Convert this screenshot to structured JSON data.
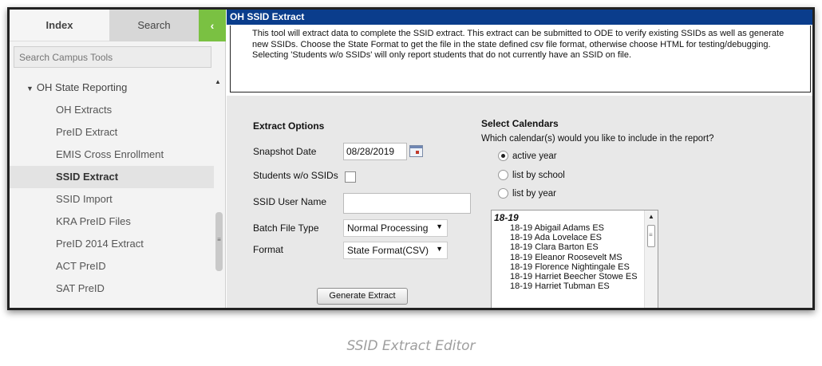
{
  "leftnav": {
    "tabs": {
      "index": "Index",
      "search": "Search",
      "collapse": "‹"
    },
    "search_placeholder": "Search Campus Tools",
    "tree": {
      "parent": "OH State Reporting",
      "items": [
        {
          "label": "OH Extracts"
        },
        {
          "label": "PreID Extract"
        },
        {
          "label": "EMIS Cross Enrollment"
        },
        {
          "label": "SSID Extract",
          "active": true
        },
        {
          "label": "SSID Import"
        },
        {
          "label": "KRA PreID Files"
        },
        {
          "label": "PreID 2014 Extract"
        },
        {
          "label": "ACT PreID"
        },
        {
          "label": "SAT PreID"
        }
      ]
    }
  },
  "main": {
    "title": "OH SSID Extract",
    "description": "This tool will extract data to complete the SSID extract. This extract can be submitted to ODE to verify existing SSIDs as well as generate new SSIDs. Choose the State Format to get the file in the state defined csv file format, otherwise choose HTML for testing/debugging. Selecting 'Students w/o SSIDs' will only report students that do not currently have an SSID on file.",
    "extract_options": {
      "title": "Extract Options",
      "snapshot_label": "Snapshot Date",
      "snapshot_value": "08/28/2019",
      "students_wo_ssid_label": "Students w/o SSIDs",
      "students_wo_ssid_checked": false,
      "ssid_user_label": "SSID User Name",
      "ssid_user_value": "",
      "batch_label": "Batch File Type",
      "batch_value": "Normal Processing",
      "format_label": "Format",
      "format_value": "State Format(CSV)",
      "generate_label": "Generate Extract"
    },
    "calendars": {
      "title": "Select Calendars",
      "question": "Which calendar(s) would you like to include in the report?",
      "options": [
        {
          "label": "active year",
          "checked": true
        },
        {
          "label": "list by school",
          "checked": false
        },
        {
          "label": "list by year",
          "checked": false
        }
      ],
      "year": "18-19",
      "entries": [
        "18-19 Abigail Adams ES",
        "18-19 Ada Lovelace ES",
        "18-19 Clara Barton ES",
        "18-19 Eleanor Roosevelt MS",
        "18-19 Florence Nightingale ES",
        "18-19 Harriet Beecher Stowe ES",
        "18-19 Harriet Tubman ES"
      ]
    }
  },
  "caption": "SSID Extract Editor"
}
